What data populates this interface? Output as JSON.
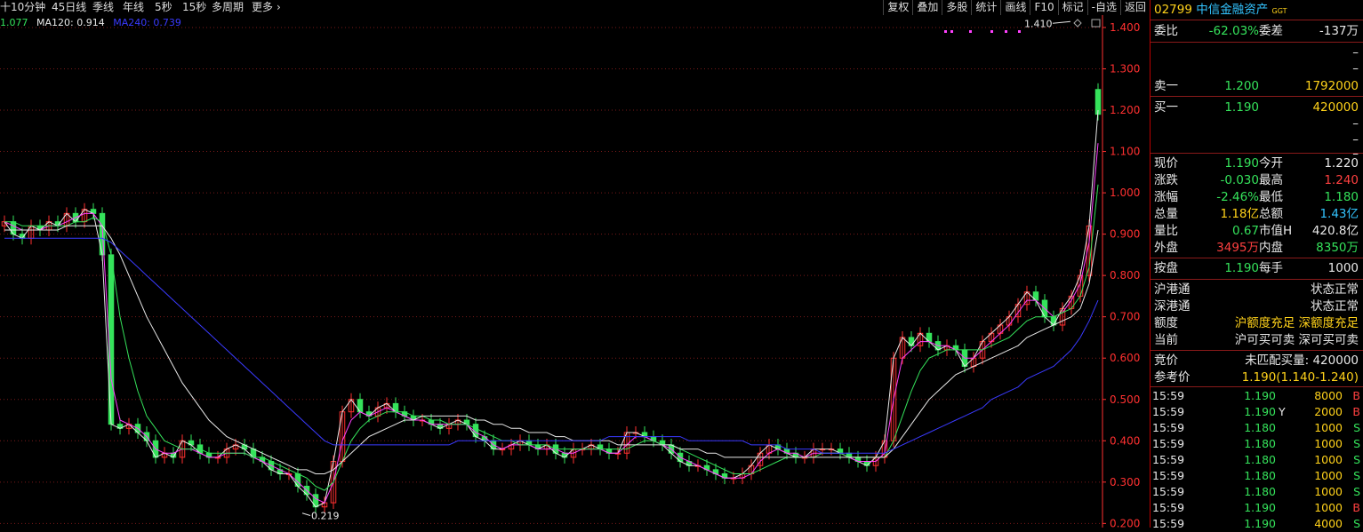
{
  "periods": [
    "十",
    "10分钟",
    "45日线",
    "季线",
    "年线",
    "5秒",
    "15秒",
    "多周期",
    "更多"
  ],
  "toolbar": [
    "复权",
    "叠加",
    "多股",
    "统计",
    "画线",
    "F10",
    "标记",
    "-自选",
    "返回"
  ],
  "ma_legend": [
    {
      "text": "1.077",
      "color": "#35e35b"
    },
    {
      "text": "MA120: 0.914",
      "color": "#e8e8e8"
    },
    {
      "text": "MA240: 0.739",
      "color": "#3a3aff"
    }
  ],
  "annotations": {
    "high": "1.410",
    "low": "0.219"
  },
  "colors": {
    "price_axis": "#ff3030",
    "grid": "#7a1a1a",
    "up": "#ff3030",
    "down": "#35e35b"
  },
  "chart_data": {
    "type": "line",
    "title": "",
    "y_ticks": [
      "1.400",
      "1.300",
      "1.200",
      "1.100",
      "1.000",
      "0.900",
      "0.800",
      "0.700",
      "0.600",
      "0.500",
      "0.400",
      "0.300",
      "0.200"
    ],
    "ylim": [
      0.19,
      1.43
    ],
    "n": 124,
    "series": [
      {
        "name": "",
        "color": "#e8e8e8",
        "values": [
          0.93,
          0.9,
          0.89,
          0.92,
          0.91,
          0.93,
          0.92,
          0.95,
          0.93,
          0.96,
          0.95,
          0.85,
          0.44,
          0.43,
          0.44,
          0.42,
          0.4,
          0.36,
          0.37,
          0.36,
          0.4,
          0.39,
          0.37,
          0.36,
          0.36,
          0.38,
          0.39,
          0.38,
          0.36,
          0.35,
          0.33,
          0.32,
          0.32,
          0.29,
          0.27,
          0.24,
          0.25,
          0.35,
          0.47,
          0.5,
          0.47,
          0.46,
          0.48,
          0.49,
          0.47,
          0.46,
          0.45,
          0.45,
          0.44,
          0.43,
          0.44,
          0.45,
          0.44,
          0.41,
          0.4,
          0.38,
          0.38,
          0.39,
          0.4,
          0.39,
          0.38,
          0.39,
          0.37,
          0.36,
          0.38,
          0.38,
          0.39,
          0.38,
          0.37,
          0.37,
          0.42,
          0.42,
          0.41,
          0.4,
          0.39,
          0.37,
          0.35,
          0.34,
          0.34,
          0.33,
          0.32,
          0.31,
          0.31,
          0.32,
          0.34,
          0.37,
          0.39,
          0.38,
          0.37,
          0.36,
          0.36,
          0.38,
          0.38,
          0.38,
          0.37,
          0.36,
          0.35,
          0.34,
          0.36,
          0.4,
          0.6,
          0.65,
          0.63,
          0.66,
          0.64,
          0.62,
          0.63,
          0.62,
          0.58,
          0.6,
          0.64,
          0.66,
          0.68,
          0.7,
          0.73,
          0.76,
          0.74,
          0.7,
          0.68,
          0.72,
          0.75,
          0.8,
          0.92,
          1.2
        ]
      },
      {
        "name": "",
        "color": "#ff40ff",
        "values": [
          0.93,
          0.92,
          0.91,
          0.91,
          0.91,
          0.92,
          0.92,
          0.93,
          0.94,
          0.95,
          0.95,
          0.92,
          0.55,
          0.45,
          0.44,
          0.43,
          0.41,
          0.38,
          0.37,
          0.37,
          0.38,
          0.38,
          0.37,
          0.36,
          0.36,
          0.37,
          0.37,
          0.37,
          0.36,
          0.35,
          0.34,
          0.33,
          0.32,
          0.3,
          0.28,
          0.26,
          0.25,
          0.3,
          0.4,
          0.45,
          0.47,
          0.46,
          0.47,
          0.48,
          0.47,
          0.46,
          0.45,
          0.45,
          0.44,
          0.44,
          0.44,
          0.44,
          0.44,
          0.42,
          0.41,
          0.39,
          0.38,
          0.39,
          0.39,
          0.39,
          0.38,
          0.38,
          0.38,
          0.37,
          0.37,
          0.38,
          0.38,
          0.38,
          0.37,
          0.37,
          0.39,
          0.41,
          0.41,
          0.4,
          0.39,
          0.38,
          0.36,
          0.35,
          0.34,
          0.33,
          0.32,
          0.31,
          0.31,
          0.31,
          0.32,
          0.35,
          0.37,
          0.38,
          0.37,
          0.37,
          0.36,
          0.37,
          0.37,
          0.37,
          0.37,
          0.36,
          0.35,
          0.35,
          0.35,
          0.37,
          0.5,
          0.6,
          0.62,
          0.64,
          0.64,
          0.63,
          0.63,
          0.62,
          0.6,
          0.6,
          0.62,
          0.64,
          0.66,
          0.68,
          0.71,
          0.74,
          0.74,
          0.72,
          0.7,
          0.71,
          0.74,
          0.78,
          0.88,
          1.12
        ]
      },
      {
        "name": "",
        "color": "#35e35b",
        "values": [
          0.93,
          0.93,
          0.92,
          0.92,
          0.92,
          0.92,
          0.92,
          0.92,
          0.93,
          0.93,
          0.94,
          0.93,
          0.85,
          0.7,
          0.6,
          0.52,
          0.46,
          0.43,
          0.4,
          0.39,
          0.38,
          0.38,
          0.38,
          0.37,
          0.37,
          0.37,
          0.37,
          0.37,
          0.36,
          0.36,
          0.35,
          0.34,
          0.33,
          0.32,
          0.31,
          0.29,
          0.28,
          0.3,
          0.35,
          0.4,
          0.43,
          0.45,
          0.46,
          0.47,
          0.47,
          0.47,
          0.46,
          0.46,
          0.45,
          0.45,
          0.44,
          0.44,
          0.44,
          0.43,
          0.42,
          0.41,
          0.4,
          0.4,
          0.39,
          0.39,
          0.39,
          0.39,
          0.38,
          0.38,
          0.38,
          0.38,
          0.38,
          0.38,
          0.38,
          0.38,
          0.38,
          0.39,
          0.4,
          0.4,
          0.39,
          0.39,
          0.38,
          0.37,
          0.36,
          0.35,
          0.34,
          0.33,
          0.32,
          0.32,
          0.32,
          0.33,
          0.34,
          0.35,
          0.36,
          0.36,
          0.36,
          0.36,
          0.37,
          0.37,
          0.37,
          0.36,
          0.36,
          0.36,
          0.36,
          0.36,
          0.4,
          0.46,
          0.52,
          0.57,
          0.6,
          0.61,
          0.62,
          0.62,
          0.62,
          0.62,
          0.62,
          0.63,
          0.64,
          0.65,
          0.67,
          0.69,
          0.7,
          0.7,
          0.7,
          0.71,
          0.72,
          0.75,
          0.82,
          1.02
        ]
      },
      {
        "name": "MA120",
        "color": "#e8e8e8",
        "values": [
          0.91,
          0.91,
          0.91,
          0.91,
          0.91,
          0.91,
          0.91,
          0.92,
          0.92,
          0.92,
          0.92,
          0.92,
          0.89,
          0.85,
          0.8,
          0.75,
          0.7,
          0.66,
          0.62,
          0.58,
          0.54,
          0.51,
          0.48,
          0.45,
          0.43,
          0.41,
          0.4,
          0.39,
          0.38,
          0.37,
          0.36,
          0.35,
          0.34,
          0.33,
          0.33,
          0.32,
          0.32,
          0.33,
          0.35,
          0.37,
          0.39,
          0.41,
          0.42,
          0.43,
          0.44,
          0.45,
          0.45,
          0.46,
          0.46,
          0.46,
          0.46,
          0.46,
          0.46,
          0.45,
          0.45,
          0.44,
          0.44,
          0.43,
          0.43,
          0.42,
          0.42,
          0.42,
          0.41,
          0.41,
          0.4,
          0.4,
          0.4,
          0.4,
          0.4,
          0.39,
          0.39,
          0.39,
          0.39,
          0.39,
          0.39,
          0.39,
          0.38,
          0.38,
          0.38,
          0.37,
          0.37,
          0.36,
          0.36,
          0.36,
          0.36,
          0.36,
          0.36,
          0.36,
          0.36,
          0.36,
          0.36,
          0.36,
          0.36,
          0.36,
          0.36,
          0.36,
          0.36,
          0.36,
          0.36,
          0.36,
          0.38,
          0.41,
          0.44,
          0.47,
          0.5,
          0.52,
          0.54,
          0.56,
          0.57,
          0.58,
          0.59,
          0.6,
          0.61,
          0.62,
          0.63,
          0.65,
          0.66,
          0.67,
          0.68,
          0.69,
          0.7,
          0.72,
          0.78,
          0.91
        ]
      },
      {
        "name": "MA240",
        "color": "#3a3aff",
        "values": [
          0.89,
          0.89,
          0.89,
          0.89,
          0.89,
          0.89,
          0.89,
          0.89,
          0.89,
          0.89,
          0.89,
          0.89,
          0.88,
          0.86,
          0.84,
          0.82,
          0.8,
          0.78,
          0.76,
          0.74,
          0.72,
          0.7,
          0.68,
          0.66,
          0.64,
          0.62,
          0.6,
          0.58,
          0.56,
          0.54,
          0.52,
          0.5,
          0.48,
          0.46,
          0.44,
          0.42,
          0.4,
          0.39,
          0.39,
          0.39,
          0.39,
          0.39,
          0.39,
          0.39,
          0.39,
          0.39,
          0.39,
          0.39,
          0.39,
          0.39,
          0.39,
          0.4,
          0.4,
          0.4,
          0.4,
          0.4,
          0.4,
          0.4,
          0.4,
          0.4,
          0.4,
          0.4,
          0.4,
          0.4,
          0.4,
          0.4,
          0.4,
          0.4,
          0.41,
          0.41,
          0.41,
          0.41,
          0.41,
          0.41,
          0.41,
          0.41,
          0.41,
          0.4,
          0.4,
          0.4,
          0.4,
          0.4,
          0.4,
          0.4,
          0.39,
          0.39,
          0.39,
          0.39,
          0.38,
          0.38,
          0.38,
          0.38,
          0.37,
          0.37,
          0.37,
          0.37,
          0.37,
          0.37,
          0.37,
          0.37,
          0.38,
          0.39,
          0.4,
          0.41,
          0.42,
          0.43,
          0.44,
          0.45,
          0.46,
          0.47,
          0.48,
          0.5,
          0.51,
          0.52,
          0.53,
          0.55,
          0.56,
          0.57,
          0.58,
          0.6,
          0.62,
          0.65,
          0.69,
          0.74
        ]
      }
    ],
    "price_bars": {
      "open": [
        0.92,
        0.93,
        0.9,
        0.89,
        0.92,
        0.91,
        0.93,
        0.92,
        0.95,
        0.93,
        0.96,
        0.95,
        0.85,
        0.44,
        0.43,
        0.44,
        0.42,
        0.4,
        0.36,
        0.37,
        0.36,
        0.4,
        0.39,
        0.37,
        0.36,
        0.36,
        0.38,
        0.39,
        0.38,
        0.36,
        0.35,
        0.33,
        0.32,
        0.32,
        0.29,
        0.27,
        0.24,
        0.25,
        0.35,
        0.47,
        0.5,
        0.47,
        0.46,
        0.48,
        0.49,
        0.47,
        0.46,
        0.45,
        0.45,
        0.44,
        0.43,
        0.44,
        0.45,
        0.44,
        0.41,
        0.4,
        0.38,
        0.38,
        0.39,
        0.4,
        0.39,
        0.38,
        0.39,
        0.37,
        0.36,
        0.38,
        0.38,
        0.39,
        0.38,
        0.37,
        0.37,
        0.42,
        0.42,
        0.41,
        0.4,
        0.39,
        0.37,
        0.35,
        0.34,
        0.34,
        0.33,
        0.32,
        0.31,
        0.31,
        0.32,
        0.34,
        0.37,
        0.39,
        0.38,
        0.37,
        0.36,
        0.36,
        0.38,
        0.38,
        0.38,
        0.37,
        0.36,
        0.35,
        0.34,
        0.36,
        0.4,
        0.6,
        0.65,
        0.63,
        0.66,
        0.64,
        0.62,
        0.63,
        0.62,
        0.58,
        0.6,
        0.64,
        0.66,
        0.68,
        0.7,
        0.73,
        0.76,
        0.74,
        0.7,
        0.68,
        0.72,
        0.75,
        0.8,
        1.25
      ],
      "close": [
        0.93,
        0.9,
        0.89,
        0.92,
        0.91,
        0.93,
        0.92,
        0.95,
        0.93,
        0.96,
        0.95,
        0.85,
        0.44,
        0.43,
        0.44,
        0.42,
        0.4,
        0.36,
        0.37,
        0.36,
        0.4,
        0.39,
        0.37,
        0.36,
        0.36,
        0.38,
        0.39,
        0.38,
        0.36,
        0.35,
        0.33,
        0.32,
        0.32,
        0.29,
        0.27,
        0.24,
        0.25,
        0.35,
        0.47,
        0.5,
        0.47,
        0.46,
        0.48,
        0.49,
        0.47,
        0.46,
        0.45,
        0.45,
        0.44,
        0.43,
        0.44,
        0.45,
        0.44,
        0.41,
        0.4,
        0.38,
        0.38,
        0.39,
        0.4,
        0.39,
        0.38,
        0.39,
        0.37,
        0.36,
        0.38,
        0.38,
        0.39,
        0.38,
        0.37,
        0.37,
        0.42,
        0.42,
        0.41,
        0.4,
        0.39,
        0.37,
        0.35,
        0.34,
        0.34,
        0.33,
        0.32,
        0.31,
        0.31,
        0.32,
        0.34,
        0.37,
        0.39,
        0.38,
        0.37,
        0.36,
        0.36,
        0.38,
        0.38,
        0.38,
        0.37,
        0.36,
        0.35,
        0.34,
        0.36,
        0.4,
        0.6,
        0.65,
        0.63,
        0.66,
        0.64,
        0.62,
        0.63,
        0.62,
        0.58,
        0.6,
        0.64,
        0.66,
        0.68,
        0.7,
        0.73,
        0.76,
        0.74,
        0.7,
        0.68,
        0.72,
        0.75,
        0.8,
        0.92,
        1.19
      ]
    }
  },
  "quote": {
    "code": "02799",
    "name": "中信金融资产",
    "tag": "GGT",
    "weibi_label": "委比",
    "weibi": "-62.03%",
    "weicha_label": "委差",
    "weicha": "-137万",
    "ask_dashes": [
      "–",
      "–"
    ],
    "ask1_label": "卖一",
    "ask1_price": "1.200",
    "ask1_vol": "1792000",
    "bid1_label": "买一",
    "bid1_price": "1.190",
    "bid1_vol": "420000",
    "bid_dashes": [
      "–",
      "–",
      "–"
    ],
    "stats": [
      {
        "l1": "现价",
        "v1": "1.190",
        "c1": "g",
        "l2": "今开",
        "v2": "1.220",
        "c2": "w"
      },
      {
        "l1": "涨跌",
        "v1": "-0.030",
        "c1": "g",
        "l2": "最高",
        "v2": "1.240",
        "c2": "red"
      },
      {
        "l1": "涨幅",
        "v1": "-2.46%",
        "c1": "g",
        "l2": "最低",
        "v2": "1.180",
        "c2": "g"
      },
      {
        "l1": "总量",
        "v1": "1.18亿",
        "c1": "y",
        "l2": "总额",
        "v2": "1.43亿",
        "c2": "c"
      },
      {
        "l1": "量比",
        "v1": "0.67",
        "c1": "g",
        "l2": "市值H",
        "v2": "420.8亿",
        "c2": "w"
      },
      {
        "l1": "外盘",
        "v1": "3495万",
        "c1": "red",
        "l2": "内盘",
        "v2": "8350万",
        "c2": "g"
      }
    ],
    "anpan_label": "按盘",
    "anpan": "1.190",
    "meishou_label": "每手",
    "meishou": "1000",
    "connect": [
      {
        "label": "沪港通",
        "value": "状态正常",
        "color": "w"
      },
      {
        "label": "深港通",
        "value": "状态正常",
        "color": "w"
      },
      {
        "label": "额度",
        "value": "沪额度充足 深额度充足",
        "color": "y"
      },
      {
        "label": "当前",
        "value": "沪可买可卖 深可买可卖",
        "color": "w"
      }
    ],
    "auction_label": "竞价",
    "auction_value": "未匹配买量: 420000",
    "ref_label": "参考价",
    "ref_value": "1.190(1.140-1.240)",
    "ticks": [
      {
        "time": "15:59",
        "price": "1.190",
        "flag": "",
        "vol": "8000",
        "side": "B"
      },
      {
        "time": "15:59",
        "price": "1.190",
        "flag": "Y",
        "vol": "2000",
        "side": "B"
      },
      {
        "time": "15:59",
        "price": "1.180",
        "flag": "",
        "vol": "1000",
        "side": "S"
      },
      {
        "time": "15:59",
        "price": "1.180",
        "flag": "",
        "vol": "1000",
        "side": "S"
      },
      {
        "time": "15:59",
        "price": "1.180",
        "flag": "",
        "vol": "1000",
        "side": "S"
      },
      {
        "time": "15:59",
        "price": "1.180",
        "flag": "",
        "vol": "1000",
        "side": "S"
      },
      {
        "time": "15:59",
        "price": "1.180",
        "flag": "",
        "vol": "1000",
        "side": "S"
      },
      {
        "time": "15:59",
        "price": "1.190",
        "flag": "",
        "vol": "1000",
        "side": "B"
      },
      {
        "time": "15:59",
        "price": "1.190",
        "flag": "",
        "vol": "4000",
        "side": "S"
      }
    ]
  }
}
